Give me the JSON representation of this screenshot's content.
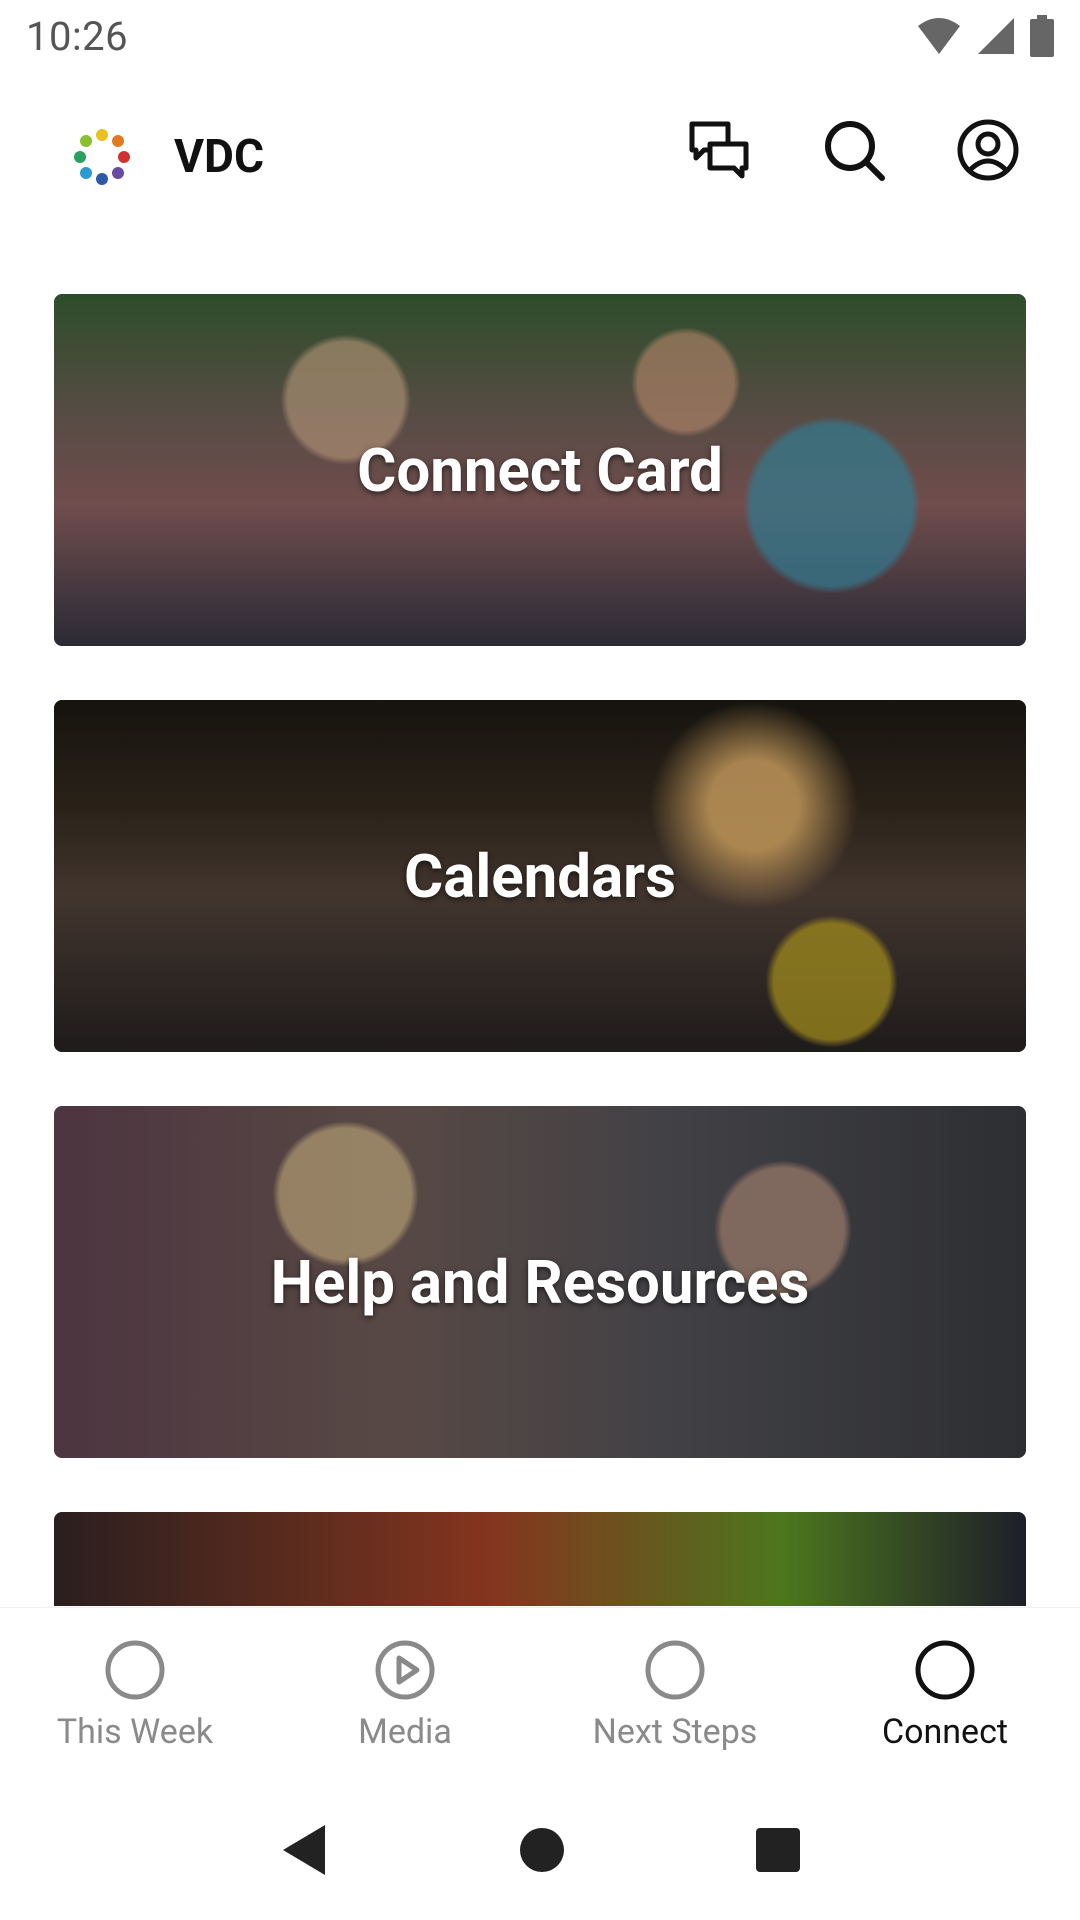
{
  "status_bar": {
    "time": "10:26"
  },
  "app_bar": {
    "title": "VDC"
  },
  "cards": [
    {
      "title": "Connect Card"
    },
    {
      "title": "Calendars"
    },
    {
      "title": "Help and Resources"
    },
    {
      "title": ""
    }
  ],
  "bottom_nav": {
    "items": [
      {
        "label": "This Week",
        "active": false
      },
      {
        "label": "Media",
        "active": false
      },
      {
        "label": "Next Steps",
        "active": false
      },
      {
        "label": "Connect",
        "active": true
      }
    ]
  }
}
